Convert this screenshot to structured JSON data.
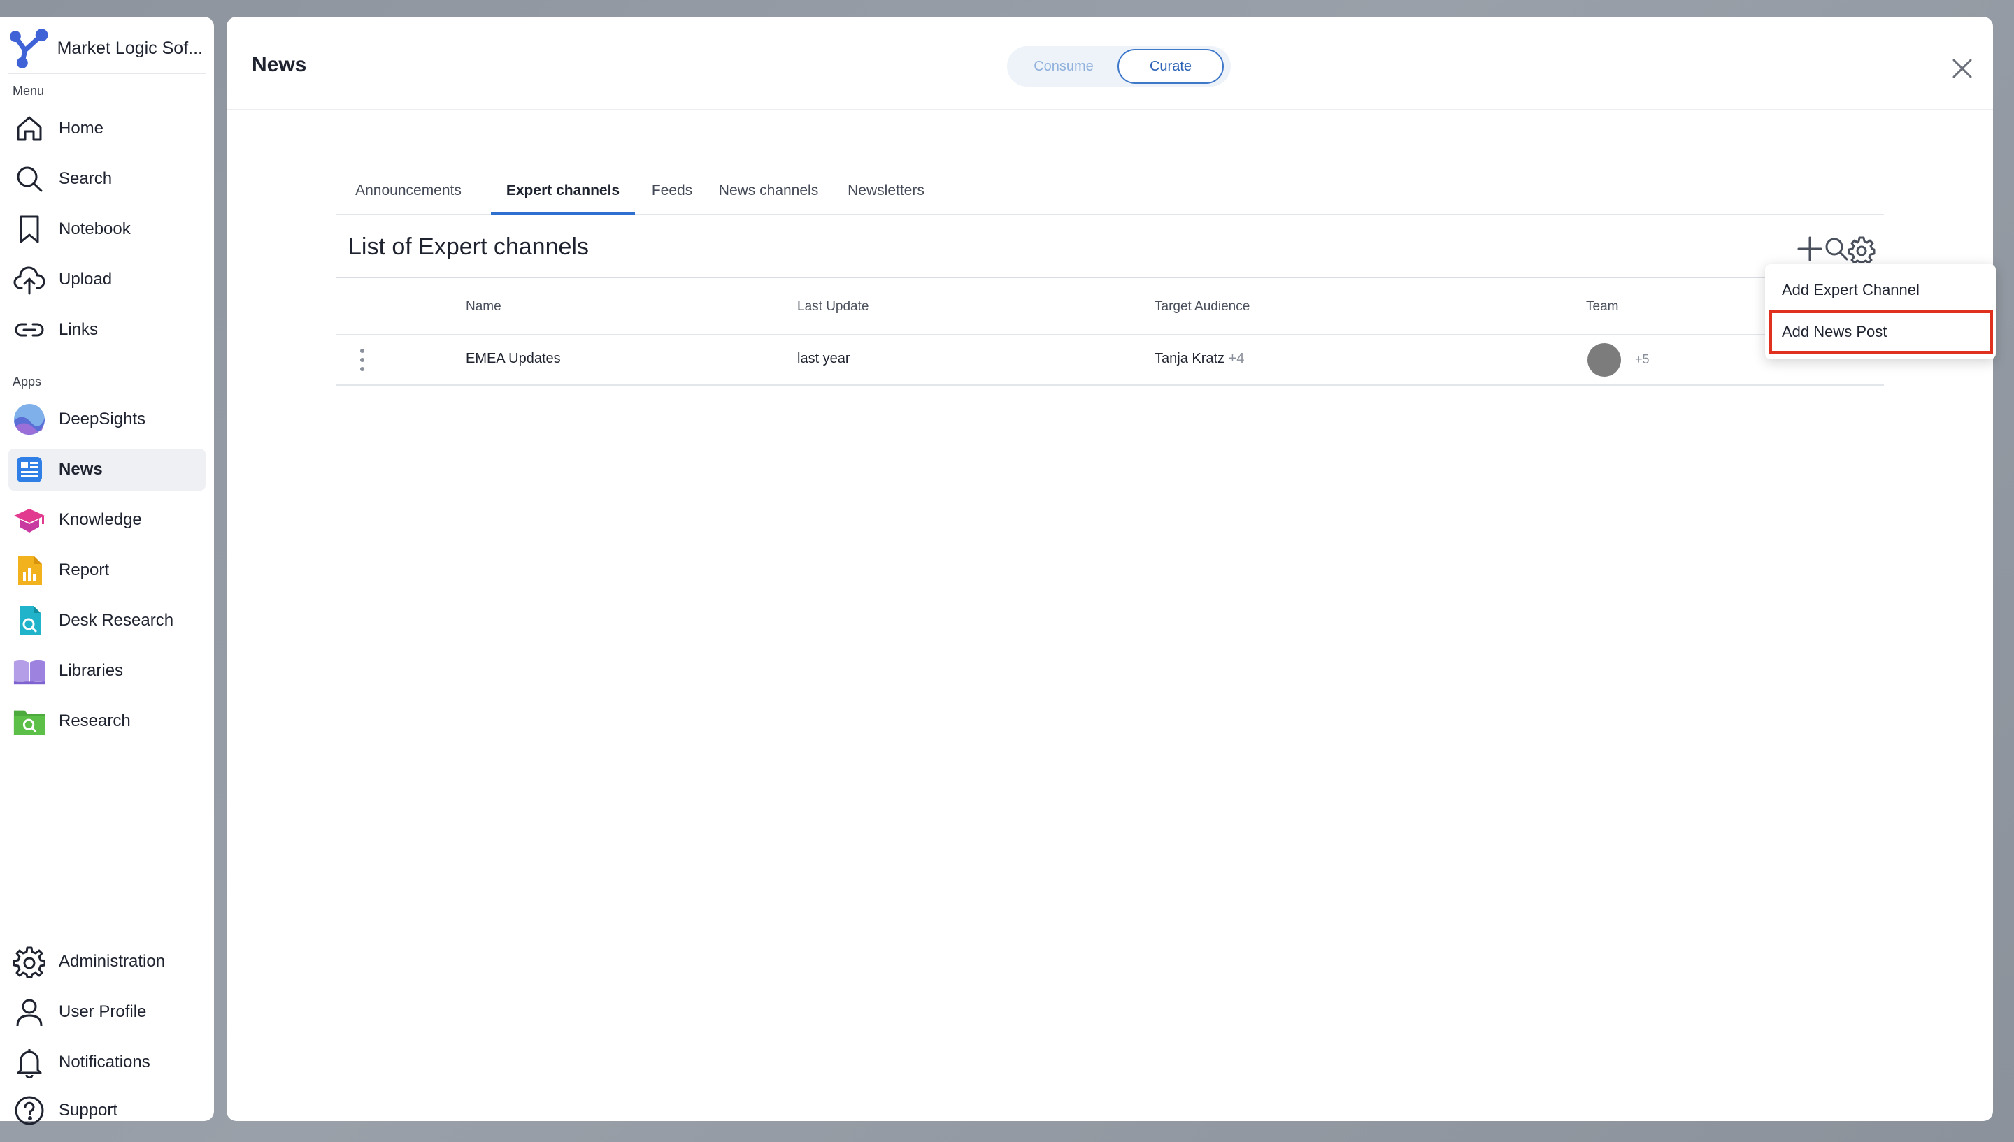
{
  "sidebar": {
    "brand_name": "Market Logic Sof...",
    "menu_label": "Menu",
    "apps_label": "Apps",
    "menu_items": [
      {
        "label": "Home",
        "icon": "home-icon"
      },
      {
        "label": "Search",
        "icon": "search-icon"
      },
      {
        "label": "Notebook",
        "icon": "bookmark-icon"
      },
      {
        "label": "Upload",
        "icon": "upload-cloud-icon"
      },
      {
        "label": "Links",
        "icon": "link-icon"
      }
    ],
    "app_items": [
      {
        "label": "DeepSights",
        "icon": "deepsights-icon"
      },
      {
        "label": "News",
        "icon": "news-icon",
        "active": true
      },
      {
        "label": "Knowledge",
        "icon": "knowledge-icon"
      },
      {
        "label": "Report",
        "icon": "report-icon"
      },
      {
        "label": "Desk Research",
        "icon": "desk-research-icon"
      },
      {
        "label": "Libraries",
        "icon": "libraries-icon"
      },
      {
        "label": "Research",
        "icon": "research-icon"
      }
    ],
    "bottom_items": [
      {
        "label": "Administration",
        "icon": "gear-icon"
      },
      {
        "label": "User Profile",
        "icon": "user-icon"
      },
      {
        "label": "Notifications",
        "icon": "bell-icon"
      },
      {
        "label": "Support",
        "icon": "help-icon"
      }
    ]
  },
  "header": {
    "title": "News",
    "toggle": {
      "consume": "Consume",
      "curate": "Curate",
      "selected": "Curate"
    }
  },
  "tabs": [
    {
      "label": "Announcements"
    },
    {
      "label": "Expert channels",
      "active": true
    },
    {
      "label": "Feeds"
    },
    {
      "label": "News channels"
    },
    {
      "label": "Newsletters"
    }
  ],
  "list": {
    "title": "List of Expert channels",
    "columns": [
      "Name",
      "Last Update",
      "Target Audience",
      "Team"
    ],
    "rows": [
      {
        "name": "EMEA Updates",
        "last_update": "last year",
        "audience": "Tanja Kratz",
        "audience_more": "+4",
        "team_more": "+5"
      }
    ]
  },
  "dropdown": {
    "items": [
      "Add Expert Channel",
      "Add News Post"
    ],
    "highlighted": "Add News Post"
  },
  "colors": {
    "accent": "#2f6fd0",
    "highlight": "#e0301e",
    "backdrop": "#8e949e"
  }
}
